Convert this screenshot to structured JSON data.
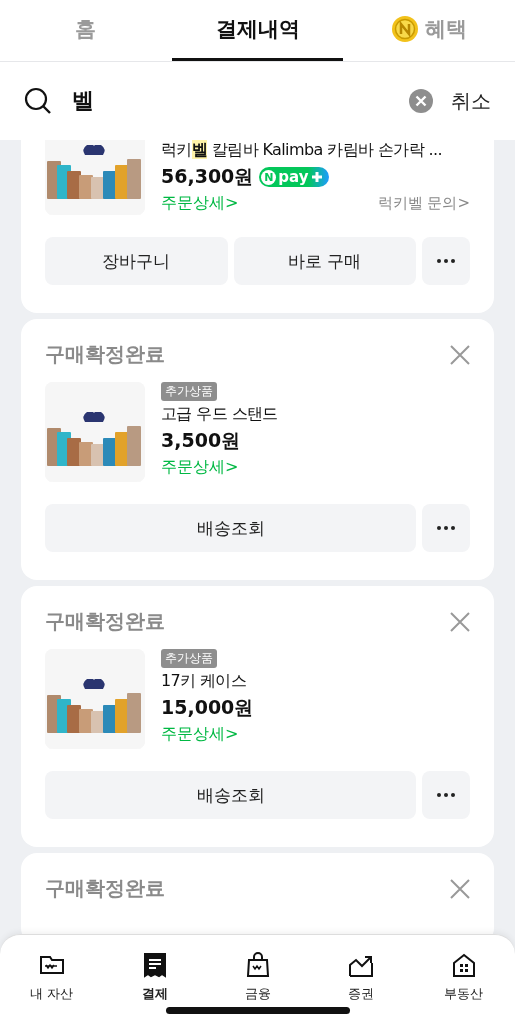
{
  "tabs": [
    {
      "kind": "text",
      "label": "홈",
      "selected": false
    },
    {
      "kind": "text",
      "label": "결제내역",
      "selected": true
    },
    {
      "kind": "coin",
      "label": "혜택",
      "selected": false
    }
  ],
  "search": {
    "value": "벨",
    "cancel": "취소"
  },
  "orders": [
    {
      "cut_top": true,
      "product": {
        "name": [
          {
            "text": "럭키",
            "highlight": false
          },
          {
            "text": "벨",
            "highlight": true
          },
          {
            "text": " 칼림바 Kalimba 카림바 손가락 ...",
            "highlight": false
          }
        ],
        "price": "56,300원",
        "pay_badge": {
          "mark": "N",
          "text": "pay"
        },
        "detail": "주문상세>",
        "seller": "럭키벨 문의>"
      },
      "buttons": [
        {
          "kind": "text",
          "label": "장바구니"
        },
        {
          "kind": "text",
          "label": "바로 구매"
        },
        {
          "kind": "more"
        }
      ]
    },
    {
      "cut_top": false,
      "status": "구매확정완료",
      "product": {
        "tag": "추가상품",
        "name": [
          {
            "text": "고급 우드 스탠드",
            "highlight": false
          }
        ],
        "price": "3,500원",
        "detail": "주문상세>"
      },
      "buttons": [
        {
          "kind": "text",
          "label": "배송조회"
        },
        {
          "kind": "more"
        }
      ]
    },
    {
      "cut_top": false,
      "status": "구매확정완료",
      "product": {
        "tag": "추가상품",
        "name": [
          {
            "text": "17키 케이스",
            "highlight": false
          }
        ],
        "price": "15,000원",
        "detail": "주문상세>"
      },
      "buttons": [
        {
          "kind": "text",
          "label": "배송조회"
        },
        {
          "kind": "more"
        }
      ]
    },
    {
      "cut_top": false,
      "status": "구매확정완료"
    }
  ],
  "nav": [
    {
      "kind": "wallet",
      "label": "내 자산",
      "selected": false
    },
    {
      "kind": "receipt",
      "label": "결제",
      "selected": true
    },
    {
      "kind": "bag",
      "label": "금융",
      "selected": false
    },
    {
      "kind": "chart",
      "label": "증권",
      "selected": false
    },
    {
      "kind": "house",
      "label": "부동산",
      "selected": false
    }
  ]
}
